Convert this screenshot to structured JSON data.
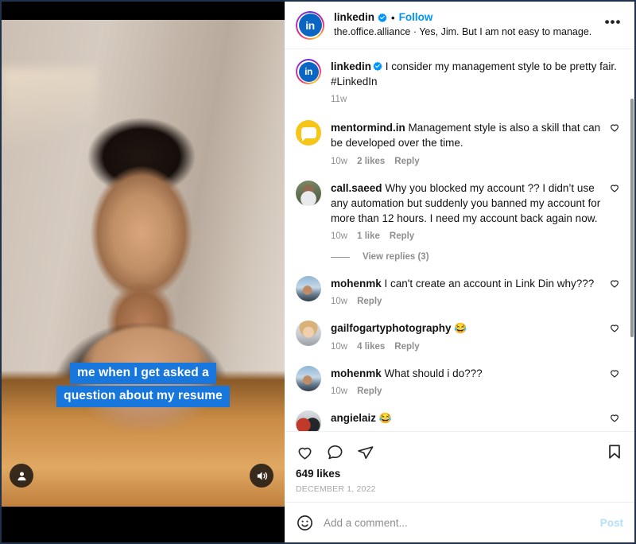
{
  "colors": {
    "accent_blue": "#0095f6",
    "caption_blue": "#1877dd",
    "linkedin_blue": "#0a66c2",
    "text_primary": "#121212",
    "text_muted": "#8e8e8e",
    "post_disabled": "#b2dffc",
    "mentormind_yellow": "#f5c518"
  },
  "media": {
    "caption_line_1": "me when I get asked a",
    "caption_line_2": "question about my resume",
    "tag_icon": "person-icon",
    "volume_icon": "volume-on-icon"
  },
  "header": {
    "avatar_icon": "linkedin-avatar",
    "avatar_text": "in",
    "username": "linkedin",
    "verified_icon": "verified-badge-icon",
    "separator": "•",
    "follow_label": "Follow",
    "subtitle": "the.office.alliance · Yes, Jim. But I am not easy to manage.",
    "more_icon": "more-options-icon",
    "more_glyph": "•••"
  },
  "caption": {
    "avatar_icon": "linkedin-avatar",
    "avatar_text": "in",
    "username": "linkedin",
    "verified_icon": "verified-badge-icon",
    "text": "I consider my management style to be pretty fair. #LinkedIn",
    "time": "11w"
  },
  "comments": [
    {
      "avatar_class": "av-mentormind",
      "avatar_icon": "mentormind-avatar",
      "username": "mentormind.in",
      "text": "Management style is also a skill that can be developed over the time.",
      "emoji": "",
      "time": "10w",
      "likes": "2 likes",
      "reply": "Reply",
      "like_icon": "heart-outline-icon",
      "view_replies": "View replies (3)",
      "has_replies": false
    },
    {
      "avatar_class": "av-saeed",
      "avatar_icon": "call-saeed-avatar",
      "username": "call.saeed",
      "text": "Why you blocked my account ?? I didn’t use any automation but suddenly you banned my account for more than 12 hours. I need my account back again now.",
      "emoji": "",
      "time": "10w",
      "likes": "1 like",
      "reply": "Reply",
      "like_icon": "heart-outline-icon",
      "view_replies": "View replies (3)",
      "has_replies": true
    },
    {
      "avatar_class": "av-mohenmk",
      "avatar_icon": "mohenmk-avatar",
      "username": "mohenmk",
      "text": "I can't create an account in Link Din why???",
      "emoji": "",
      "time": "10w",
      "likes": "",
      "reply": "Reply",
      "like_icon": "heart-outline-icon",
      "view_replies": "",
      "has_replies": false
    },
    {
      "avatar_class": "av-gail",
      "avatar_icon": "gailfogartyphotography-avatar",
      "username": "gailfogartyphotography",
      "text": "",
      "emoji": "😂",
      "time": "10w",
      "likes": "4 likes",
      "reply": "Reply",
      "like_icon": "heart-outline-icon",
      "view_replies": "",
      "has_replies": false
    },
    {
      "avatar_class": "av-mohenmk",
      "avatar_icon": "mohenmk-avatar",
      "username": "mohenmk",
      "text": "What should i do???",
      "emoji": "",
      "time": "10w",
      "likes": "",
      "reply": "Reply",
      "like_icon": "heart-outline-icon",
      "view_replies": "",
      "has_replies": false
    },
    {
      "avatar_class": "av-angielaiz",
      "avatar_icon": "angielaiz-avatar",
      "username": "angielaiz",
      "text": "",
      "emoji": "😂",
      "time": "",
      "likes": "",
      "reply": "",
      "like_icon": "heart-outline-icon",
      "view_replies": "",
      "has_replies": false
    }
  ],
  "actions": {
    "like_icon": "heart-outline-icon",
    "comment_icon": "comment-bubble-icon",
    "share_icon": "share-paper-plane-icon",
    "save_icon": "bookmark-outline-icon",
    "likes_count": "649 likes",
    "date": "DECEMBER 1, 2022"
  },
  "add_comment": {
    "emoji_icon": "emoji-smiley-icon",
    "placeholder": "Add a comment...",
    "value": "",
    "post_label": "Post"
  }
}
